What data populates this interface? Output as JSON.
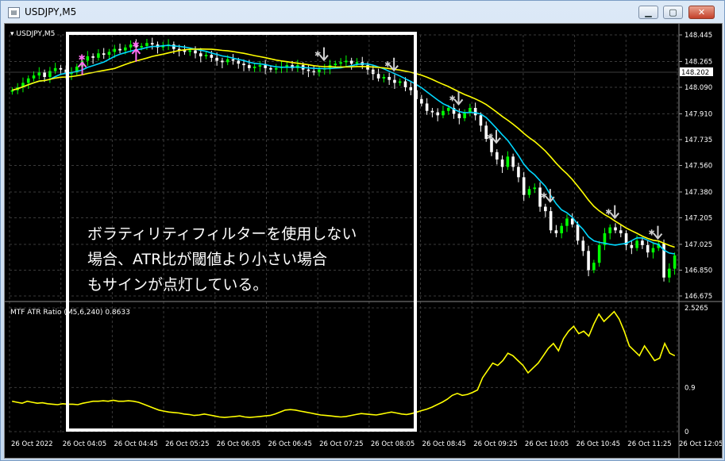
{
  "window": {
    "title": "USDJPY,M5",
    "minimize_label": "▁",
    "maximize_label": "▢",
    "close_label": "✕",
    "icon": "chart-window-icon"
  },
  "colors": {
    "background": "#000000",
    "bull_candle": "#00ff00",
    "bear_candle": "#ffffff",
    "ma_fast": "#00d8ff",
    "ma_slow": "#ffff00",
    "atr_line": "#ffff00",
    "grid": "#3a3a3a",
    "up_signal": "#ff6ef0",
    "down_signal": "#d0d0d0",
    "annotation_frame": "#ffffff"
  },
  "main_chart": {
    "label": "USDJPY,M5",
    "current_price": "148.202",
    "annotation_lines": [
      "ボラティリティフィルターを使用しない",
      "場合、ATR比が閾値より小さい場合",
      "もサインが点灯している。"
    ]
  },
  "sub_chart": {
    "label": "MTF ATR Ratio (M5,6,240) 0.8633"
  },
  "chart_data": [
    {
      "type": "candlestick",
      "title": "USDJPY,M5",
      "y_ticks": [
        "148.445",
        "148.265",
        "148.090",
        "147.910",
        "147.735",
        "147.560",
        "147.380",
        "147.205",
        "147.025",
        "146.850",
        "146.675"
      ],
      "ylim": [
        146.675,
        148.445
      ],
      "x_ticks": [
        "26 Oct 2022",
        "26 Oct 04:05",
        "26 Oct 04:45",
        "26 Oct 05:25",
        "26 Oct 06:05",
        "26 Oct 06:45",
        "26 Oct 07:25",
        "26 Oct 08:05",
        "26 Oct 08:45",
        "26 Oct 09:25",
        "26 Oct 10:05",
        "26 Oct 10:45",
        "26 Oct 11:25",
        "26 Oct 12:05"
      ],
      "close": [
        148.07,
        148.09,
        148.12,
        148.15,
        148.17,
        148.19,
        148.16,
        148.2,
        148.22,
        148.21,
        148.18,
        148.19,
        148.23,
        148.27,
        148.3,
        148.29,
        148.32,
        148.31,
        148.33,
        148.35,
        148.34,
        148.36,
        148.38,
        148.36,
        148.37,
        148.39,
        148.38,
        148.36,
        148.37,
        148.38,
        148.35,
        148.34,
        148.33,
        148.34,
        148.32,
        148.3,
        148.31,
        148.29,
        148.27,
        148.26,
        148.28,
        148.27,
        148.25,
        148.24,
        148.22,
        148.23,
        148.24,
        148.22,
        148.21,
        148.22,
        148.23,
        148.24,
        148.22,
        148.24,
        148.21,
        148.2,
        148.19,
        148.21,
        148.22,
        148.24,
        148.25,
        148.26,
        148.27,
        148.25,
        148.26,
        148.24,
        148.21,
        148.18,
        148.15,
        148.16,
        148.14,
        148.12,
        148.13,
        148.09,
        148.07,
        148.01,
        147.98,
        147.93,
        147.92,
        147.9,
        147.93,
        147.95,
        147.91,
        147.88,
        147.92,
        147.95,
        147.9,
        147.83,
        147.74,
        147.65,
        147.6,
        147.55,
        147.62,
        147.55,
        147.48,
        147.36,
        147.4,
        147.41,
        147.28,
        147.25,
        147.12,
        147.1,
        147.15,
        147.2,
        147.16,
        147.05,
        146.98,
        146.85,
        146.9,
        147.02,
        147.1,
        147.14,
        147.12,
        147.1,
        147.02,
        147.0,
        147.05,
        147.02,
        146.97,
        147.0,
        147.03,
        146.8,
        146.86,
        146.95
      ],
      "open": [
        148.06,
        148.07,
        148.09,
        148.12,
        148.15,
        148.17,
        148.19,
        148.16,
        148.2,
        148.22,
        148.21,
        148.18,
        148.19,
        148.23,
        148.27,
        148.3,
        148.29,
        148.32,
        148.31,
        148.33,
        148.35,
        148.34,
        148.36,
        148.38,
        148.36,
        148.37,
        148.39,
        148.38,
        148.36,
        148.37,
        148.38,
        148.35,
        148.34,
        148.33,
        148.34,
        148.32,
        148.3,
        148.31,
        148.29,
        148.27,
        148.26,
        148.28,
        148.27,
        148.25,
        148.24,
        148.22,
        148.23,
        148.24,
        148.22,
        148.21,
        148.22,
        148.23,
        148.24,
        148.22,
        148.24,
        148.21,
        148.2,
        148.19,
        148.21,
        148.22,
        148.24,
        148.25,
        148.26,
        148.27,
        148.25,
        148.26,
        148.24,
        148.21,
        148.18,
        148.15,
        148.16,
        148.14,
        148.12,
        148.13,
        148.09,
        148.07,
        148.01,
        147.98,
        147.93,
        147.92,
        147.9,
        147.93,
        147.95,
        147.91,
        147.88,
        147.92,
        147.95,
        147.9,
        147.83,
        147.74,
        147.65,
        147.6,
        147.55,
        147.62,
        147.55,
        147.48,
        147.36,
        147.4,
        147.41,
        147.28,
        147.25,
        147.12,
        147.1,
        147.15,
        147.2,
        147.16,
        147.05,
        146.98,
        146.85,
        146.9,
        147.02,
        147.1,
        147.14,
        147.12,
        147.1,
        147.02,
        147.0,
        147.05,
        147.02,
        146.97,
        147.0,
        147.03,
        146.8,
        146.86
      ]
    },
    {
      "type": "line",
      "title": "MTF ATR Ratio (M5,6,240) 0.8633",
      "y_ticks": [
        "2.5265",
        "0.9",
        "0"
      ],
      "ylim": [
        0,
        2.5265
      ],
      "values": [
        0.62,
        0.6,
        0.58,
        0.62,
        0.6,
        0.58,
        0.59,
        0.57,
        0.56,
        0.55,
        0.57,
        0.56,
        0.56,
        0.55,
        0.58,
        0.6,
        0.62,
        0.62,
        0.63,
        0.62,
        0.64,
        0.62,
        0.62,
        0.63,
        0.62,
        0.6,
        0.56,
        0.52,
        0.48,
        0.44,
        0.42,
        0.4,
        0.39,
        0.38,
        0.36,
        0.35,
        0.33,
        0.34,
        0.36,
        0.34,
        0.32,
        0.3,
        0.29,
        0.3,
        0.31,
        0.32,
        0.3,
        0.29,
        0.3,
        0.31,
        0.32,
        0.33,
        0.36,
        0.4,
        0.44,
        0.45,
        0.44,
        0.42,
        0.4,
        0.38,
        0.36,
        0.34,
        0.33,
        0.32,
        0.31,
        0.3,
        0.31,
        0.33,
        0.35,
        0.37,
        0.36,
        0.35,
        0.34,
        0.36,
        0.38,
        0.4,
        0.38,
        0.36,
        0.35,
        0.37,
        0.4,
        0.43,
        0.46,
        0.5,
        0.55,
        0.6,
        0.66,
        0.74,
        0.78,
        0.74,
        0.76,
        0.8,
        0.85,
        1.1,
        1.25,
        1.4,
        1.35,
        1.45,
        1.6,
        1.55,
        1.45,
        1.35,
        1.2,
        1.3,
        1.4,
        1.55,
        1.7,
        1.8,
        1.65,
        1.9,
        2.05,
        2.15,
        2.0,
        2.05,
        1.95,
        2.2,
        2.4,
        2.25,
        2.35,
        2.45,
        2.3,
        2.05,
        1.75,
        1.65,
        1.55,
        1.75,
        1.6,
        1.45,
        1.5,
        1.8,
        1.6,
        1.55
      ]
    }
  ]
}
